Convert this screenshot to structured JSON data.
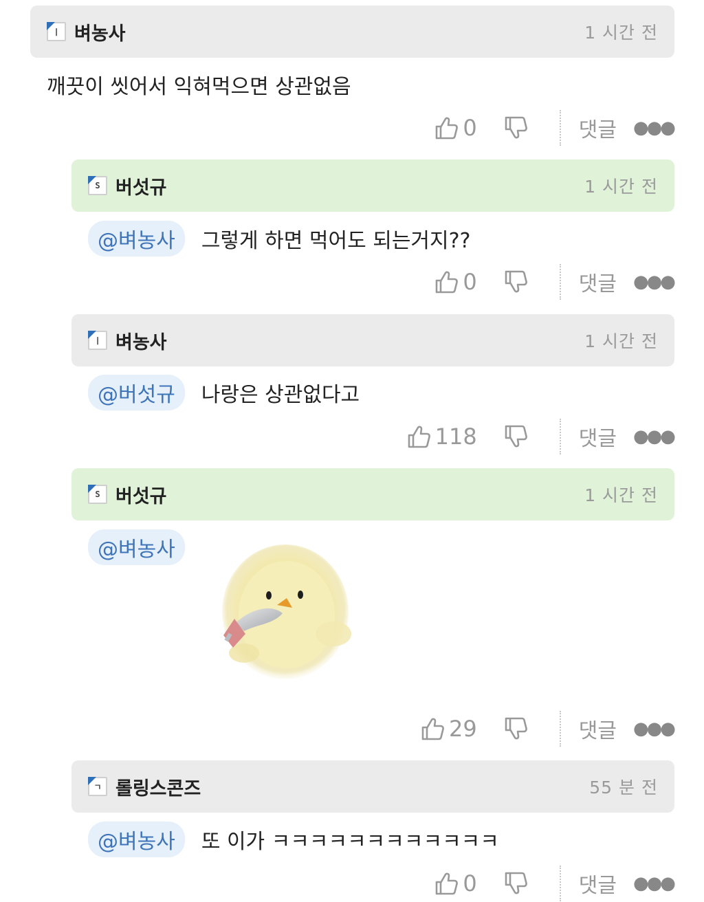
{
  "comments": [
    {
      "badge": "ㅣ",
      "name": "벼농사",
      "time": "1 시간 전",
      "text": "깨끗이 씻어서 익혀먹으면 상관없음",
      "likes": "0",
      "reply_label": "댓글"
    },
    {
      "badge": "S",
      "name": "버섯규",
      "time": "1 시간 전",
      "mention": "@벼농사",
      "text": "그렇게 하면 먹어도 되는거지??",
      "likes": "0",
      "reply_label": "댓글"
    },
    {
      "badge": "ㅣ",
      "name": "벼농사",
      "time": "1 시간 전",
      "mention": "@버섯규",
      "text": "나랑은 상관없다고",
      "likes": "118",
      "reply_label": "댓글"
    },
    {
      "badge": "S",
      "name": "버섯규",
      "time": "1 시간 전",
      "mention": "@벼농사",
      "image": "chick-with-knife",
      "likes": "29",
      "reply_label": "댓글"
    },
    {
      "badge": "ㄱ",
      "name": "롤링스콘즈",
      "time": "55 분 전",
      "mention": "@벼농사",
      "text": "또 이가 ㅋㅋㅋㅋㅋㅋㅋㅋㅋㅋㅋㅋ",
      "likes": "0",
      "reply_label": "댓글"
    }
  ],
  "icons": {
    "like": "thumbs-up-icon",
    "dislike": "thumbs-down-icon",
    "more": "more-dots-icon"
  },
  "colors": {
    "header_gray": "#ebebeb",
    "header_green": "#e0f3d9",
    "mention_bg": "#e6f0fa",
    "mention_text": "#3e74b8",
    "badge_accent": "#2f6fb7"
  }
}
